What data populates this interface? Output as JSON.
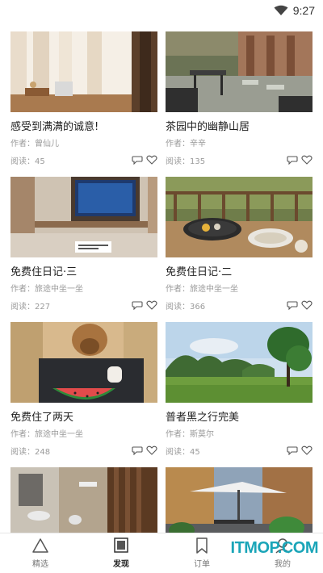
{
  "status_bar": {
    "time": "9:27"
  },
  "cards": [
    {
      "title": "感受到满满的诚意!",
      "author": "作者：曾仙儿",
      "reads": "阅读：45"
    },
    {
      "title": "茶园中的幽静山居",
      "author": "作者：辛辛",
      "reads": "阅读：135"
    },
    {
      "title": "免费住日记·三",
      "author": "作者：旅途中坐一坐",
      "reads": "阅读：227"
    },
    {
      "title": "免费住日记·二",
      "author": "作者：旅途中坐一坐",
      "reads": "阅读：366"
    },
    {
      "title": "免费住了两天",
      "author": "作者：旅途中坐一坐",
      "reads": "阅读：248"
    },
    {
      "title": "普者黑之行完美",
      "author": "作者：斯莫尔",
      "reads": "阅读：45"
    },
    {
      "title": "",
      "author": "",
      "reads": ""
    },
    {
      "title": "",
      "author": "",
      "reads": ""
    }
  ],
  "tabbar": {
    "items": [
      {
        "label": "精选",
        "icon": "triangle-icon"
      },
      {
        "label": "发现",
        "icon": "square-icon"
      },
      {
        "label": "订单",
        "icon": "bookmark-icon"
      },
      {
        "label": "我的",
        "icon": "user-icon"
      }
    ],
    "active_index": 1
  },
  "watermark": "ITMOP.COM"
}
